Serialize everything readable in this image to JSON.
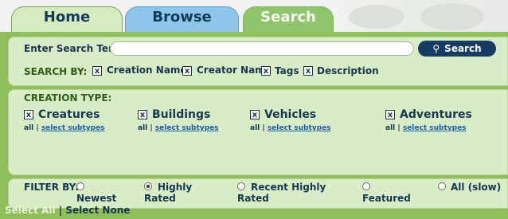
{
  "tabs": [
    {
      "label": "Home"
    },
    {
      "label": "Browse"
    },
    {
      "label": "Search"
    }
  ],
  "search": {
    "label": "Enter Search Ter",
    "button": "Search",
    "search_by_label": "SEARCH BY:",
    "options": [
      {
        "label": "Creation Name",
        "checked": true
      },
      {
        "label": "Creator Name",
        "checked": true
      },
      {
        "label": "Tags",
        "checked": true
      },
      {
        "label": "Description",
        "checked": true
      }
    ]
  },
  "creation_type": {
    "label": "CREATION TYPE:",
    "items": [
      {
        "label": "Creatures",
        "checked": true,
        "all": "all",
        "sep": "|",
        "sub": "select subtypes"
      },
      {
        "label": "Buildings",
        "checked": true,
        "all": "all",
        "sep": "|",
        "sub": "select subtypes"
      },
      {
        "label": "Vehicles",
        "checked": true,
        "all": "all",
        "sep": "|",
        "sub": "select subtypes"
      },
      {
        "label": "Adventures",
        "checked": true,
        "all": "all",
        "sep": "|",
        "sub": "select subtypes"
      }
    ]
  },
  "filter": {
    "label": "FILTER BY:",
    "options": [
      {
        "line1": "",
        "line2": "Newest",
        "selected": false
      },
      {
        "line1": "Highly",
        "line2": "Rated",
        "selected": true
      },
      {
        "line1": "Recent Highly",
        "line2": "Rated",
        "selected": false
      },
      {
        "line1": "",
        "line2": "Featured",
        "selected": false
      },
      {
        "line1": "All (slow)",
        "line2": "",
        "selected": false
      }
    ]
  },
  "footer": {
    "select_all": "Select All",
    "sep": "|",
    "select_none": "Select None"
  }
}
